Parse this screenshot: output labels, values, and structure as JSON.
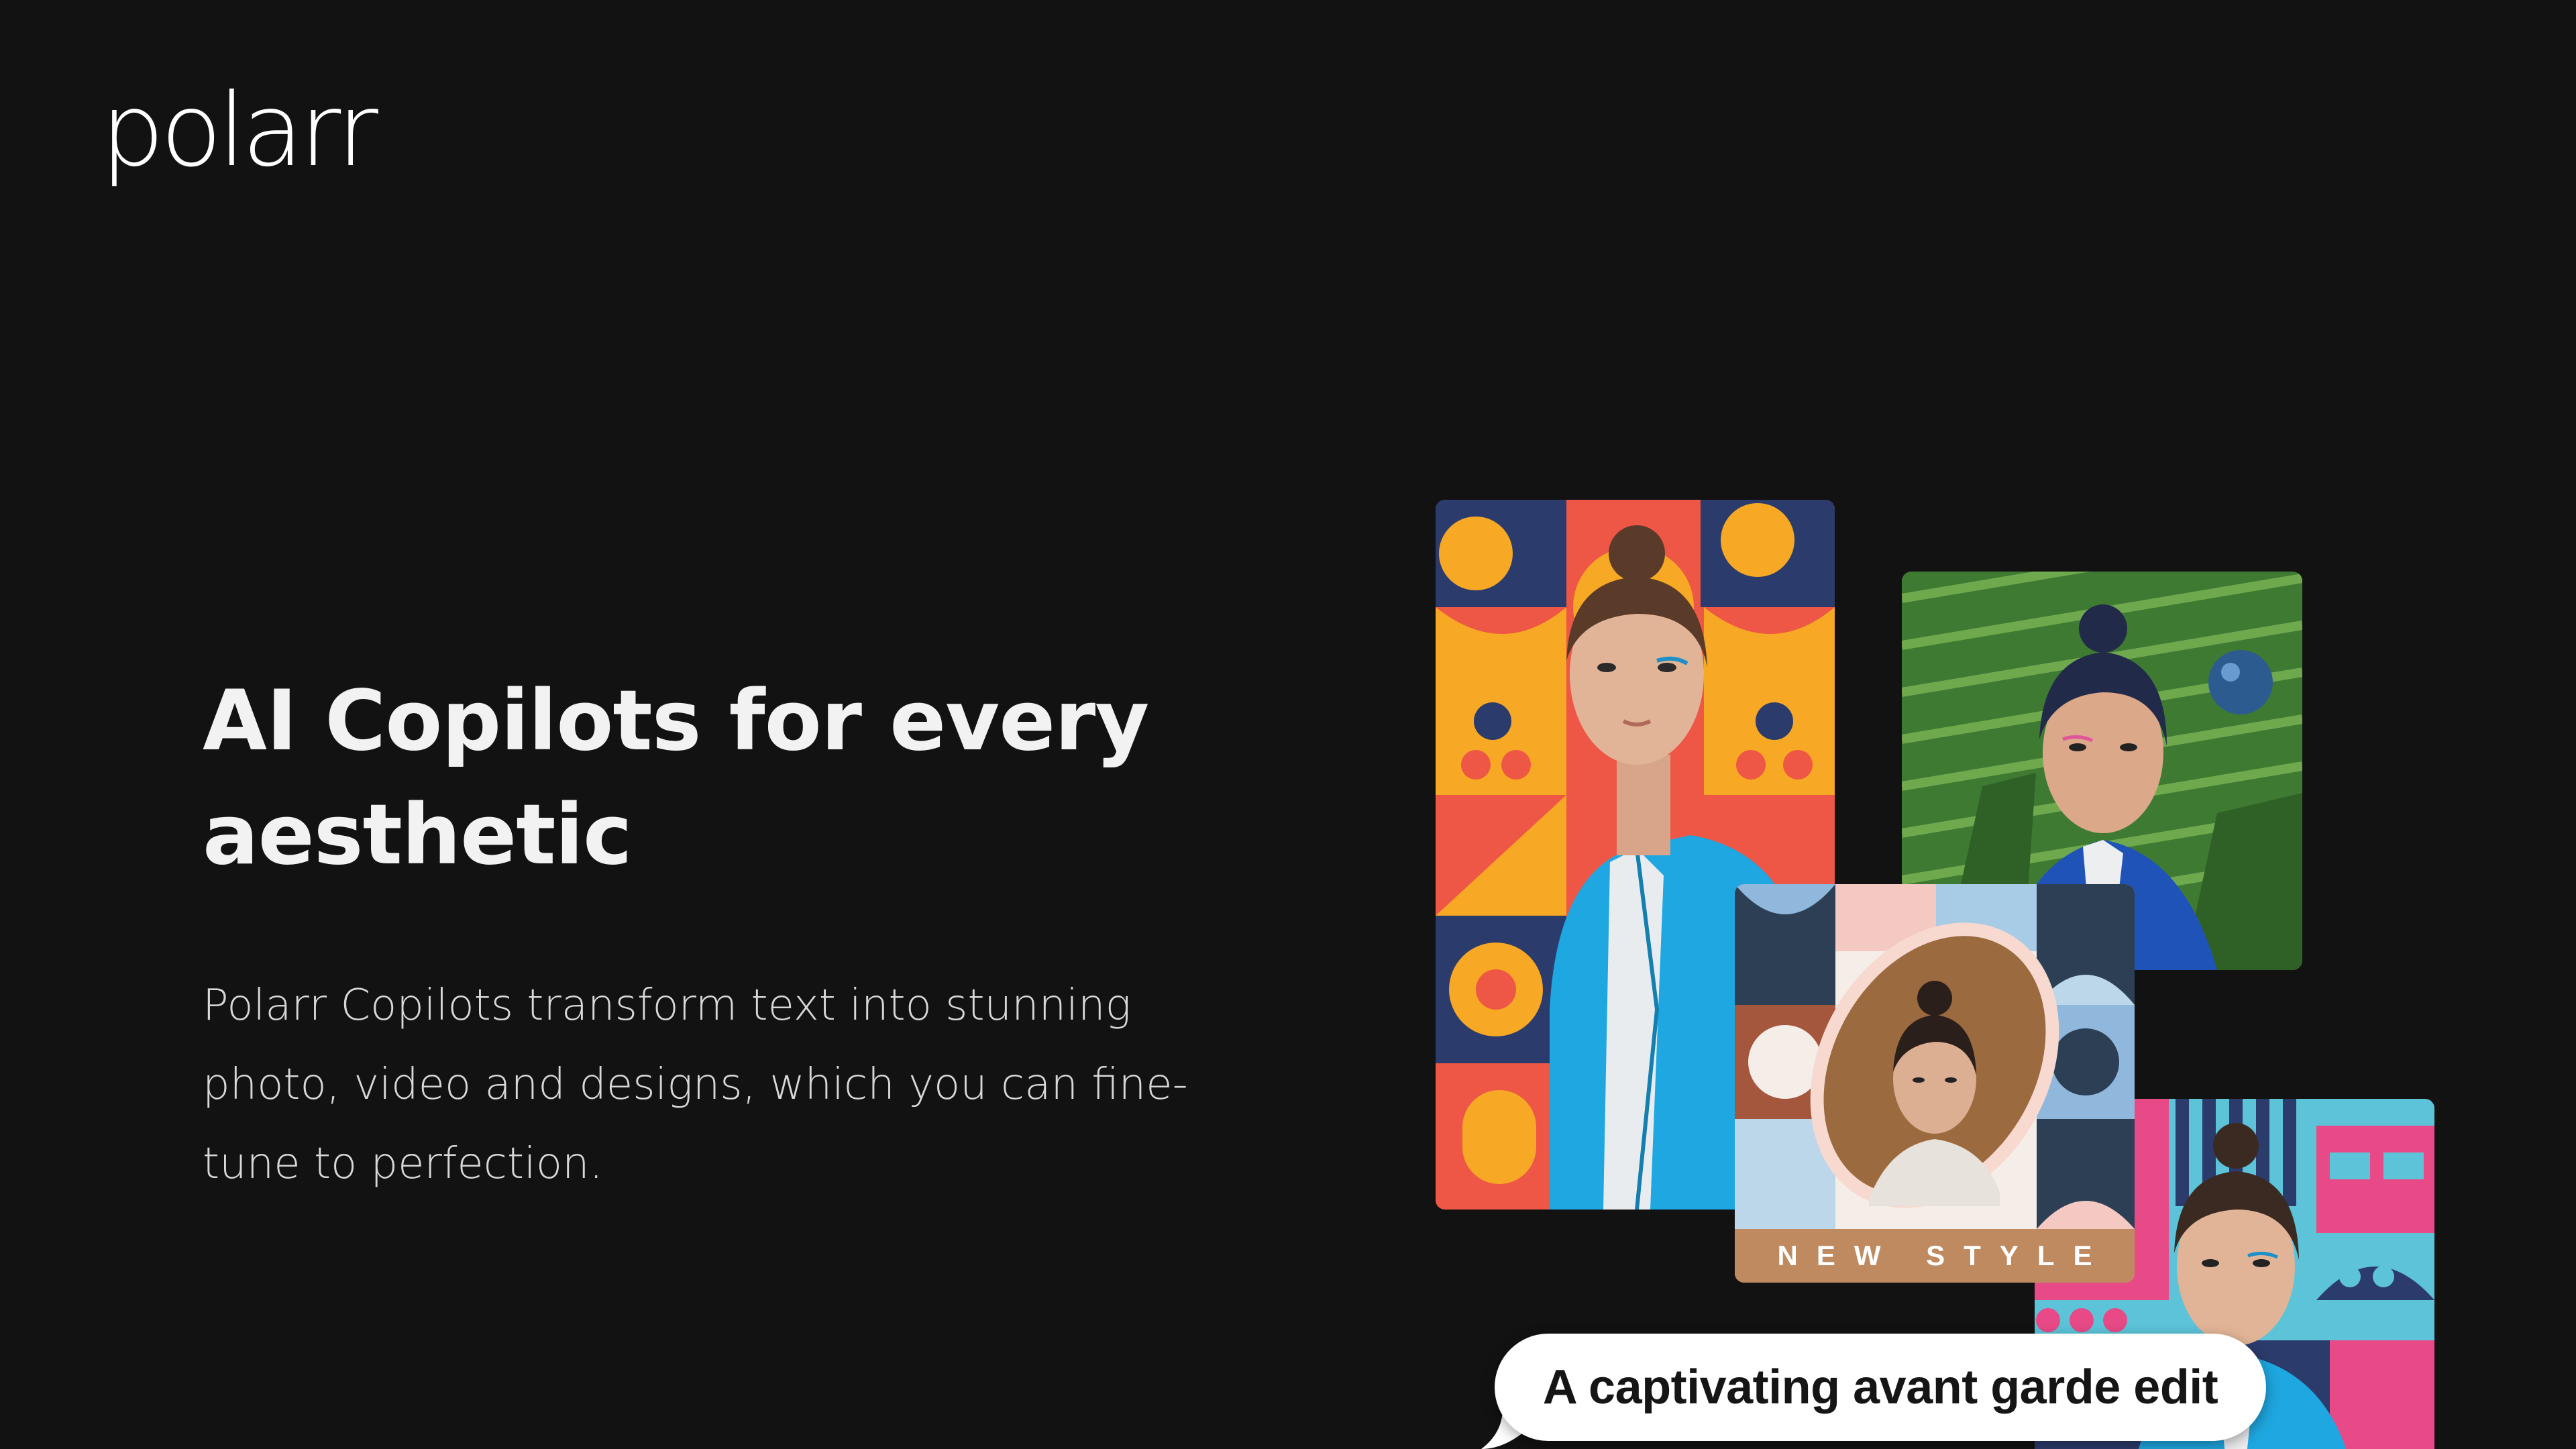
{
  "brand": {
    "logo_text": "polarr"
  },
  "hero": {
    "title": "AI Copilots for every aesthetic",
    "description": "Polarr Copilots transform text into stunning photo, video and designs, which you can fine-tune to perfection."
  },
  "collage": {
    "new_style_label": "NEW STYLE",
    "prompt_bubble": "A captivating avant garde edit"
  },
  "colors": {
    "background": "#121212",
    "text_primary": "#f2f2f2",
    "text_secondary": "#d8d8d8",
    "accent_blue": "#1ea7e0",
    "accent_orange": "#f7a824",
    "accent_red": "#ee5646",
    "accent_green": "#4f8a3a",
    "accent_pink": "#e74a86",
    "label_tan": "#c08a60"
  }
}
